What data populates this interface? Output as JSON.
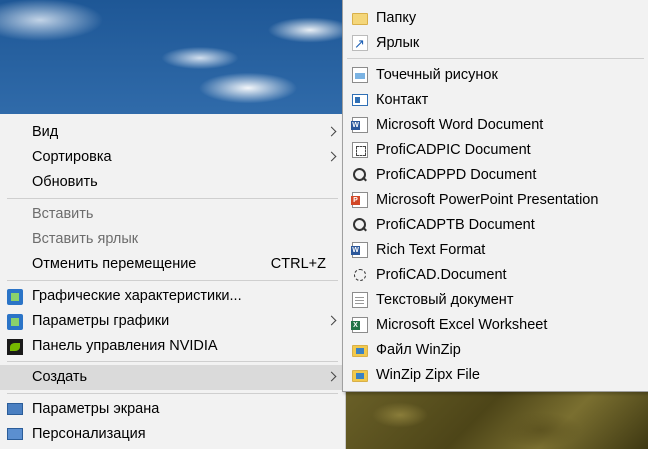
{
  "context_menu": {
    "items": [
      {
        "label": "Вид",
        "has_submenu": true
      },
      {
        "label": "Сортировка",
        "has_submenu": true
      },
      {
        "label": "Обновить"
      },
      {
        "label": "Вставить",
        "disabled": true
      },
      {
        "label": "Вставить ярлык",
        "disabled": true
      },
      {
        "label": "Отменить перемещение",
        "shortcut": "CTRL+Z"
      },
      {
        "label": "Графические характеристики...",
        "icon": "graphics-icon"
      },
      {
        "label": "Параметры графики",
        "icon": "graphics-icon",
        "has_submenu": true
      },
      {
        "label": "Панель управления NVIDIA",
        "icon": "nvidia-icon"
      },
      {
        "label": "Создать",
        "has_submenu": true,
        "highlighted": true
      },
      {
        "label": "Параметры экрана",
        "icon": "display-icon"
      },
      {
        "label": "Персонализация",
        "icon": "personalize-icon"
      }
    ]
  },
  "create_submenu": {
    "items": [
      {
        "label": "Папку",
        "icon": "folder-icon"
      },
      {
        "label": "Ярлык",
        "icon": "shortcut-icon"
      },
      {
        "label": "Точечный рисунок",
        "icon": "bitmap-icon"
      },
      {
        "label": "Контакт",
        "icon": "contact-icon"
      },
      {
        "label": "Microsoft Word Document",
        "icon": "word-icon"
      },
      {
        "label": "ProfiCADPIC Document",
        "icon": "proficad-pic-icon"
      },
      {
        "label": "ProfiCADPPD Document",
        "icon": "proficad-ppd-icon"
      },
      {
        "label": "Microsoft PowerPoint Presentation",
        "icon": "powerpoint-icon"
      },
      {
        "label": "ProfiCADPTB Document",
        "icon": "proficad-ptb-icon"
      },
      {
        "label": "Rich Text Format",
        "icon": "rtf-icon"
      },
      {
        "label": "ProfiCAD.Document",
        "icon": "proficad-doc-icon"
      },
      {
        "label": "Текстовый документ",
        "icon": "text-doc-icon"
      },
      {
        "label": "Microsoft Excel Worksheet",
        "icon": "excel-icon"
      },
      {
        "label": "Файл WinZip",
        "icon": "winzip-icon"
      },
      {
        "label": "WinZip Zipx File",
        "icon": "winzip-zipx-icon"
      }
    ]
  },
  "colors": {
    "menu_bg": "#f2f2f2",
    "highlight": "#dadada",
    "disabled_text": "#6d6d6d"
  }
}
